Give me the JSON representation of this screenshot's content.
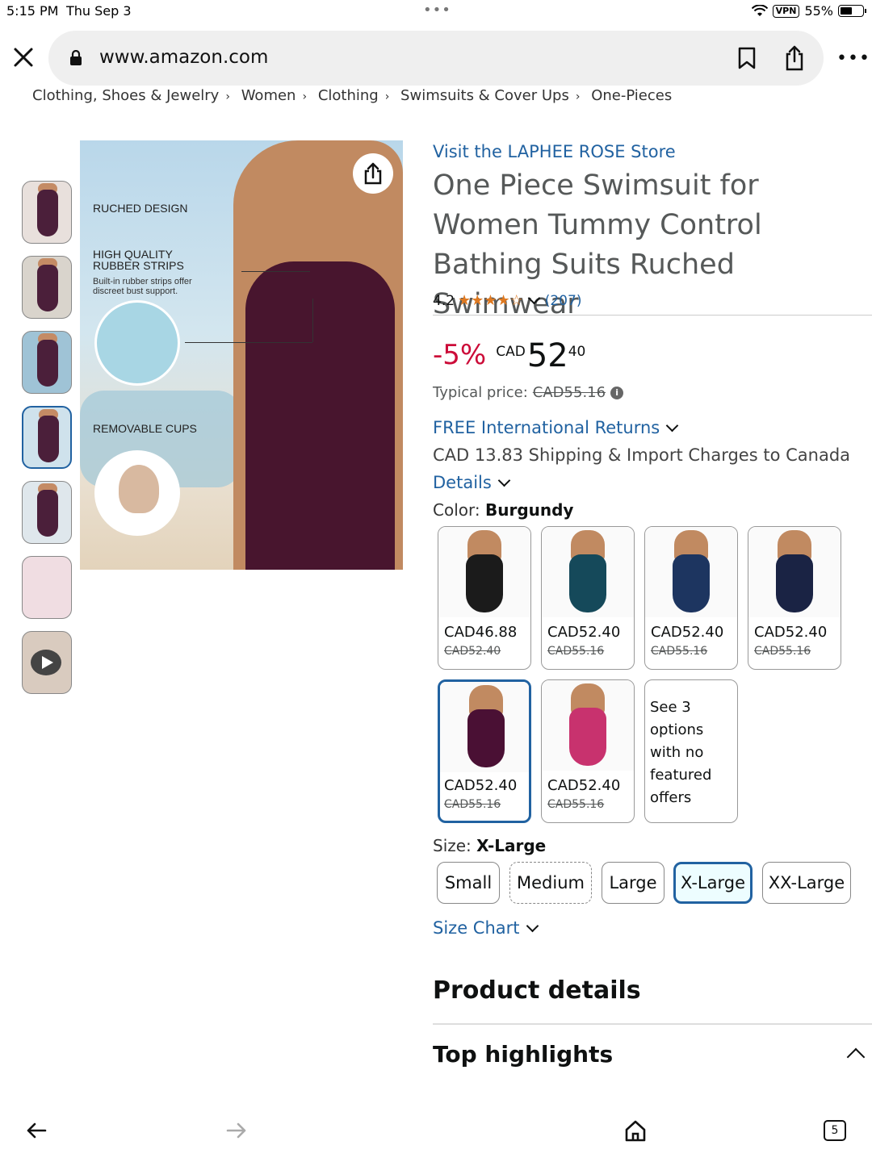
{
  "status": {
    "time": "5:15 PM",
    "date": "Thu Sep 3",
    "vpn": "VPN",
    "battery": "55%"
  },
  "browser": {
    "url": "www.amazon.com",
    "tab_count": "5"
  },
  "breadcrumb": [
    "Clothing, Shoes & Jewelry",
    "Women",
    "Clothing",
    "Swimsuits & Cover Ups",
    "One-Pieces"
  ],
  "image_labels": {
    "ruched": "RUCHED DESIGN",
    "rubber_1": "HIGH QUALITY",
    "rubber_2": "RUBBER STRIPS",
    "rubber_sub_1": "Built-in rubber strips offer",
    "rubber_sub_2": "discreet bust support.",
    "cups": "REMOVABLE CUPS"
  },
  "product": {
    "store_link": "Visit the LAPHEE ROSE Store",
    "title": "One Piece Swimsuit for Women Tummy Control Bathing Suits Ruched Swimwear",
    "rating_value": "4.2",
    "stars": "★★★★☆",
    "rating_count": "(207)",
    "discount": "-5%",
    "currency": "CAD",
    "price_whole": "52",
    "price_fraction": "40",
    "typical_label": "Typical price:",
    "typical_price": "CAD55.16",
    "returns": "FREE International Returns",
    "shipping": "CAD 13.83 Shipping & Import Charges to Canada",
    "details": "Details"
  },
  "color": {
    "label": "Color:",
    "selected": "Burgundy",
    "swatches": [
      {
        "price": "CAD46.88",
        "old": "CAD52.40",
        "color": "#1b1b1b"
      },
      {
        "price": "CAD52.40",
        "old": "CAD55.16",
        "color": "#15495a"
      },
      {
        "price": "CAD52.40",
        "old": "CAD55.16",
        "color": "#1d3560"
      },
      {
        "price": "CAD52.40",
        "old": "CAD55.16",
        "color": "#1a2344"
      },
      {
        "price": "CAD52.40",
        "old": "CAD55.16",
        "color": "#4a1034"
      },
      {
        "price": "CAD52.40",
        "old": "CAD55.16",
        "color": "#c8326e"
      }
    ],
    "more_options": "See 3 options with no featured offers"
  },
  "size": {
    "label": "Size:",
    "selected": "X-Large",
    "options": [
      "Small",
      "Medium",
      "Large",
      "X-Large",
      "XX-Large"
    ],
    "chart_link": "Size Chart"
  },
  "sections": {
    "product_details": "Product details",
    "top_highlights": "Top highlights"
  }
}
